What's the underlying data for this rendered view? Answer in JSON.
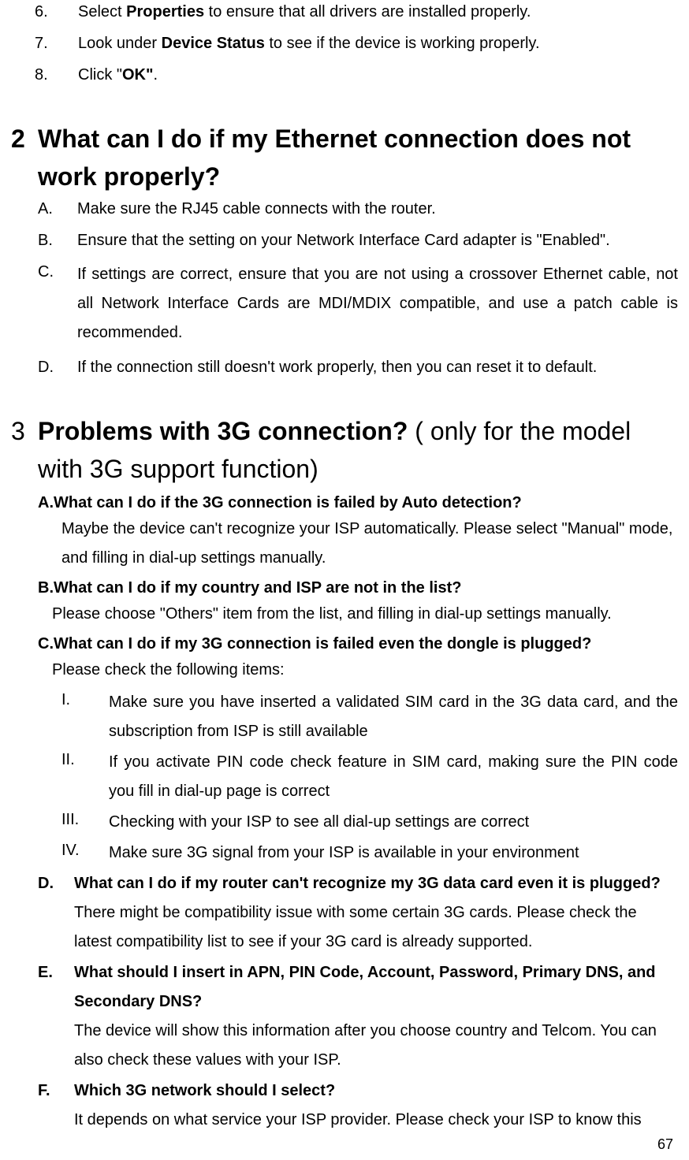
{
  "top_list": {
    "items": [
      {
        "n": "6.",
        "pre": "Select ",
        "bold": "Properties",
        "post": " to ensure that all drivers are installed properly."
      },
      {
        "n": "7.",
        "pre": "Look under ",
        "bold": "Device Status",
        "post": " to see if the device is working properly."
      },
      {
        "n": "8.",
        "pre": "Click \"",
        "bold": "OK\"",
        "post": "."
      }
    ]
  },
  "sec2": {
    "num": "2",
    "title": "What can I do if my Ethernet connection does not work properly?",
    "items": [
      {
        "m": "A.",
        "t": "Make sure the RJ45 cable connects with the router."
      },
      {
        "m": "B.",
        "t": "Ensure that the setting on your Network Interface Card adapter is \"Enabled\"."
      },
      {
        "m": "C.",
        "t": "If settings are correct, ensure that you are not using a crossover Ethernet cable, not all Network Interface Cards are MDI/MDIX compatible, and use a patch cable is recommended."
      },
      {
        "m": "D.",
        "t": "If the connection still doesn't work properly, then you can reset it to default."
      }
    ]
  },
  "sec3": {
    "num": "3",
    "title_bold": "Problems with 3G connection?",
    "title_rest": " ( only for the model with 3G support function)",
    "qA": {
      "label": "A.",
      "title": "What can I do if the 3G connection is failed by Auto detection?",
      "answer": "Maybe the device can't recognize your ISP automatically. Please select \"Manual\" mode, and filling in dial-up settings manually."
    },
    "qB": {
      "label": "B.",
      "title": "What can I do if my country and ISP are not in the list?",
      "answer": "Please choose \"Others\" item from the list, and filling in dial-up settings manually."
    },
    "qC": {
      "label": "C.",
      "title": "What can I do if my 3G connection is failed even the dongle is plugged?",
      "intro": "Please check the following items:",
      "items": [
        {
          "r": "I.",
          "t": "Make sure you have inserted a validated SIM card in the 3G data card, and the subscription from ISP is still available"
        },
        {
          "r": "II.",
          "t": "If you activate PIN code check feature in SIM card, making sure the PIN code you fill in dial-up page is correct"
        },
        {
          "r": "III.",
          "t": "Checking with your ISP to see all dial-up settings are correct"
        },
        {
          "r": "IV.",
          "t": "Make sure 3G signal from your ISP is available in your environment"
        }
      ]
    },
    "qD": {
      "label": "D.",
      "title": "What can I do if my router can't recognize my 3G data card even it is plugged?",
      "answer": "There might be compatibility issue with some certain 3G cards. Please check the latest compatibility list to see if your 3G card is already supported."
    },
    "qE": {
      "label": "E.",
      "title": "What should I insert in APN, PIN Code, Account, Password, Primary DNS, and Secondary DNS?",
      "answer": "The device will show this information after you choose country and Telcom. You can also check these values with your ISP."
    },
    "qF": {
      "label": "F.",
      "title": "Which 3G network should I select?",
      "answer": "It depends on what service your ISP provider. Please check your ISP to know this"
    }
  },
  "page_num": "67"
}
